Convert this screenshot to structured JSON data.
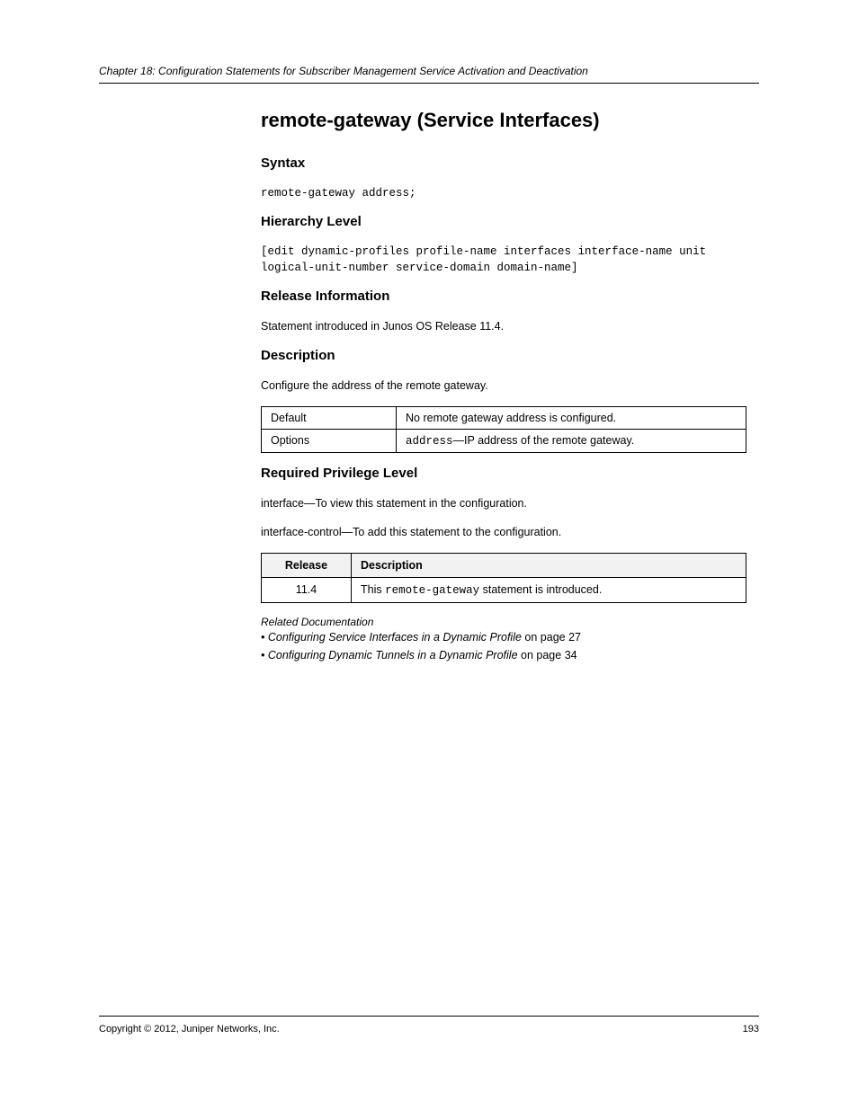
{
  "header": {
    "left": "Chapter 18: Configuration Statements for Subscriber Management Service Activation and Deactivation",
    "right": ""
  },
  "title": "remote-gateway (Service Interfaces)",
  "section": {
    "syntax_label": "Syntax",
    "syntax_code": "remote-gateway address;",
    "hierarchy_label": "Hierarchy Level",
    "hierarchy_code": "[edit dynamic-profiles profile-name interfaces interface-name unit logical-unit-number service-domain domain-name]",
    "release_label": "Release Information",
    "release_text": "Statement introduced in Junos OS Release 11.4.",
    "description_label": "Description",
    "description_text": "Configure the address of the remote gateway.",
    "required_label": "Required Privilege Level",
    "required_lines": [
      "interface—To view this statement in the configuration.",
      "interface-control—To add this statement to the configuration."
    ]
  },
  "table1": {
    "r1c1": "Default",
    "r1c2": "No remote gateway address is configured.",
    "r2c1": "Options",
    "r2c2_label": "address",
    "r2c2_text": "—IP address of the remote gateway."
  },
  "table2": {
    "h1": "Release",
    "h2": "Description",
    "r1c1": "11.4",
    "r1c2a": "This ",
    "r1c2b": "remote-gateway",
    "r1c2c": " statement is introduced."
  },
  "related": {
    "label": "Related Documentation",
    "items": [
      {
        "title": "Configuring Service Interfaces in a Dynamic Profile",
        "page": "27"
      },
      {
        "title": "Configuring Dynamic Tunnels in a Dynamic Profile",
        "page": "34"
      }
    ]
  },
  "footer": {
    "left": "Copyright © 2012, Juniper Networks, Inc.",
    "right": "193"
  }
}
